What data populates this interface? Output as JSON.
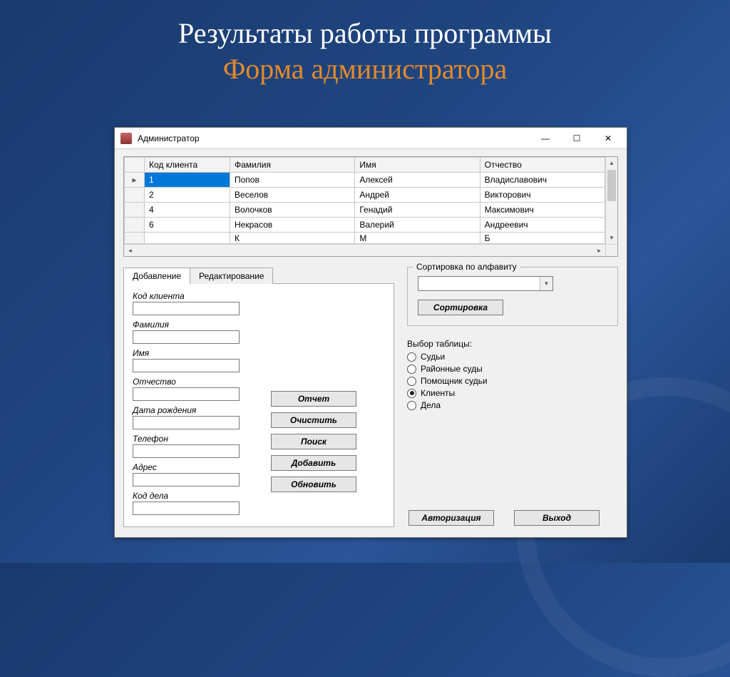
{
  "slide": {
    "title_line1": "Результаты работы программы",
    "title_line2": "Форма администратора"
  },
  "window": {
    "title": "Администратор"
  },
  "grid": {
    "headers": [
      "Код клиента",
      "Фамилия",
      "Имя",
      "Отчество"
    ],
    "rows": [
      {
        "id": "1",
        "lastname": "Попов",
        "firstname": "Алексей",
        "patronymic": "Владиславович"
      },
      {
        "id": "2",
        "lastname": "Веселов",
        "firstname": "Андрей",
        "patronymic": "Викторович"
      },
      {
        "id": "4",
        "lastname": "Волочков",
        "firstname": "Генадий",
        "patronymic": "Максимович"
      },
      {
        "id": "6",
        "lastname": "Некрасов",
        "firstname": "Валерий",
        "patronymic": "Андреевич"
      }
    ],
    "partial_row": {
      "id": "",
      "lastname": "К",
      "firstname": "М",
      "patronymic": "Б"
    },
    "selected_index": 0,
    "row_marker": "▸"
  },
  "tabs": {
    "add": "Добавление",
    "edit": "Редактирование"
  },
  "form": {
    "client_code": "Код клиента",
    "lastname": "Фамилия",
    "firstname": "Имя",
    "patronymic": "Отчество",
    "birthdate": "Дата рождения",
    "phone": "Телефон",
    "address": "Адрес",
    "case_code": "Код дела"
  },
  "buttons": {
    "report": "Отчет",
    "clear": "Очистить",
    "search": "Поиск",
    "add": "Добавить",
    "update": "Обновить",
    "sort": "Сортировка",
    "auth": "Авторизация",
    "exit": "Выход"
  },
  "sort": {
    "group_title": "Сортировка по алфавиту",
    "selected": ""
  },
  "table_select": {
    "label": "Выбор таблицы:",
    "options": [
      {
        "key": "judges",
        "label": "Судьи",
        "checked": false
      },
      {
        "key": "district",
        "label": "Районные суды",
        "checked": false
      },
      {
        "key": "assistant",
        "label": "Помощник судьи",
        "checked": false
      },
      {
        "key": "clients",
        "label": "Клиенты",
        "checked": true
      },
      {
        "key": "cases",
        "label": "Дела",
        "checked": false
      }
    ]
  }
}
